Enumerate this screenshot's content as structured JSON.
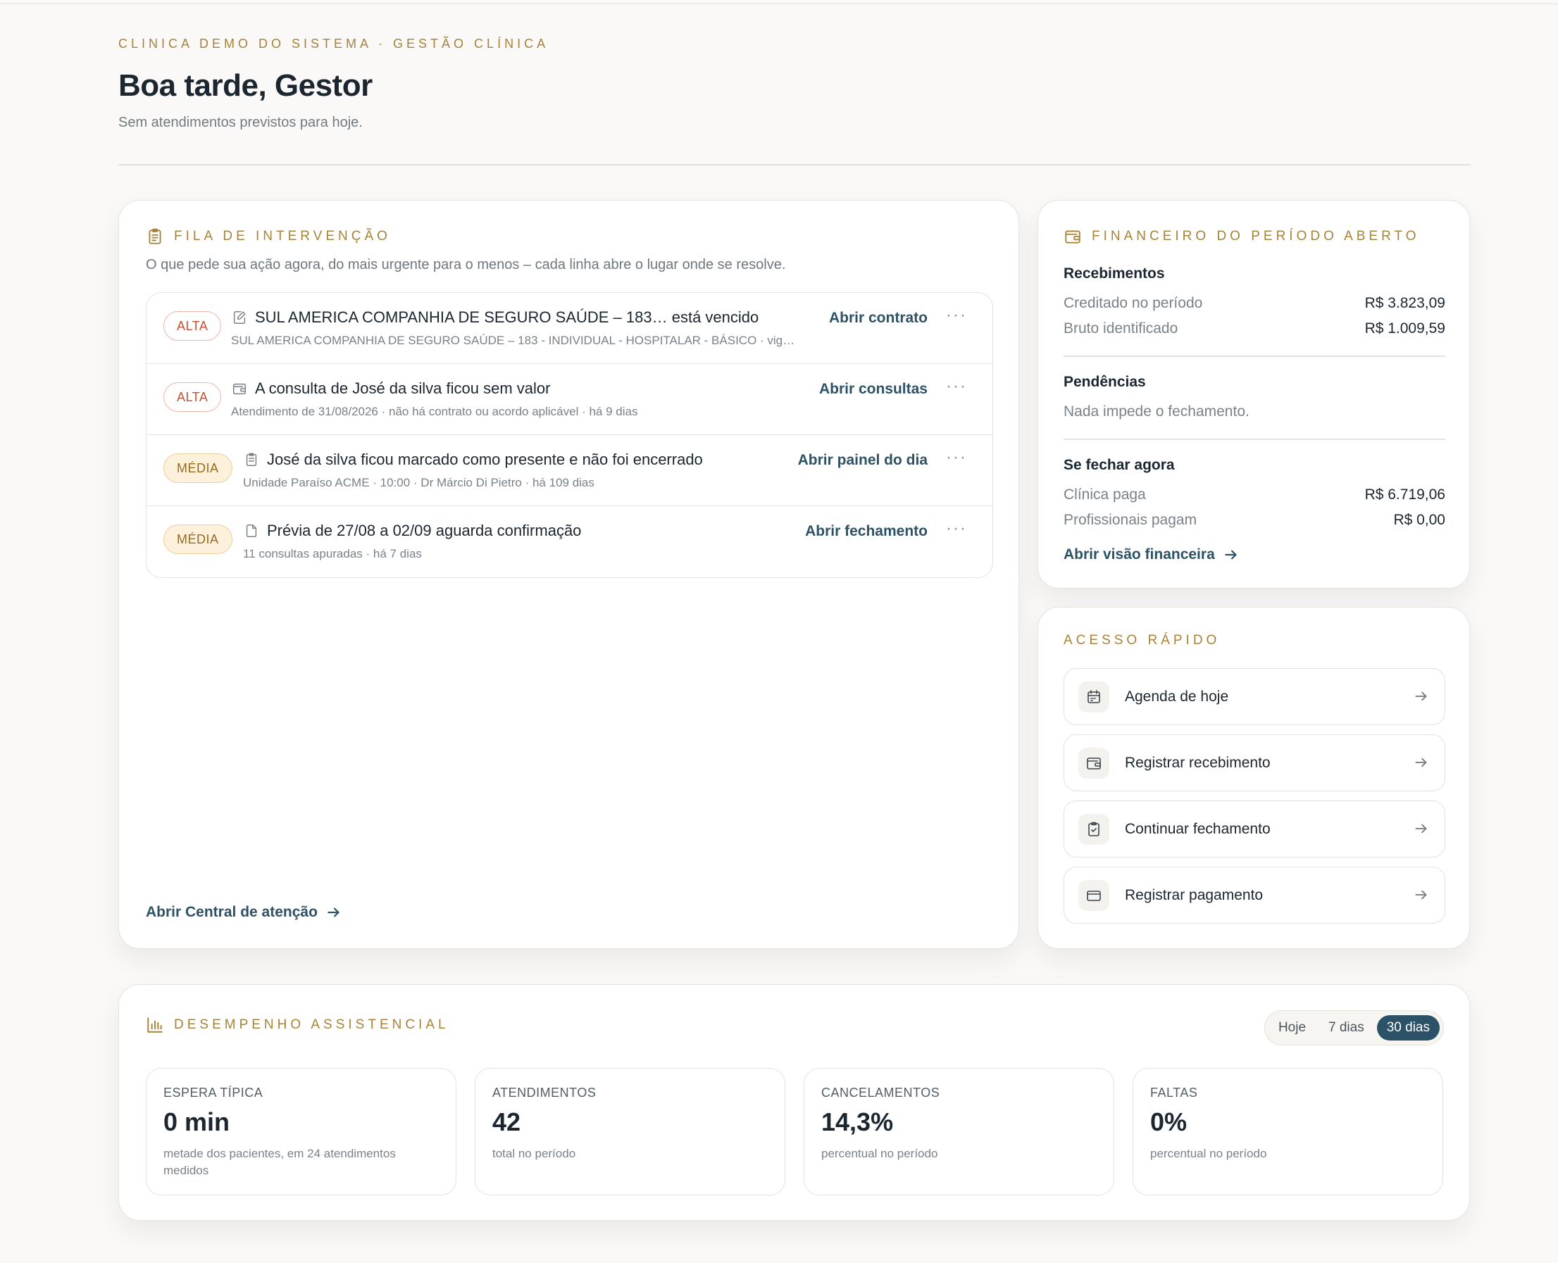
{
  "header": {
    "eyebrow": "CLINICA DEMO DO SISTEMA · GESTÃO CLÍNICA",
    "greeting": "Boa tarde, Gestor",
    "subtitle": "Sem atendimentos previstos para hoje."
  },
  "fila": {
    "title": "FILA DE INTERVENÇÃO",
    "description": "O que pede sua ação agora, do mais urgente para o menos – cada linha abre o lugar onde se resolve.",
    "rows": [
      {
        "badge": "ALTA",
        "icon": "contract-edit-icon",
        "title": "SUL AMERICA COMPANHIA DE SEGURO SAÚDE – 183… está vencido",
        "subtitle": "SUL AMERICA COMPANHIA DE SEGURO SAÚDE – 183 - INDIVIDUAL - HOSPITALAR - BÁSICO · vig…",
        "action": "Abrir contrato",
        "more": "···"
      },
      {
        "badge": "ALTA",
        "icon": "wallet-icon",
        "title": "A consulta de José da silva ficou sem valor",
        "subtitle": "Atendimento de 31/08/2026 · não há contrato ou acordo aplicável · há 9 dias",
        "action": "Abrir consultas",
        "more": "···"
      },
      {
        "badge": "MÉDIA",
        "icon": "clipboard-icon",
        "title": "José da silva ficou marcado como presente e não foi encerrado",
        "subtitle": "Unidade Paraíso ACME · 10:00 · Dr Márcio Di Pietro · há 109 dias",
        "action": "Abrir painel do dia",
        "more": "···"
      },
      {
        "badge": "MÉDIA",
        "icon": "document-icon",
        "title": "Prévia de 27/08 a 02/09 aguarda confirmação",
        "subtitle": "11 consultas apuradas · há 7 dias",
        "action": "Abrir fechamento",
        "more": "···"
      }
    ],
    "footer_link": "Abrir Central de atenção"
  },
  "financeiro": {
    "title": "FINANCEIRO DO PERÍODO ABERTO",
    "recebimentos": {
      "heading": "Recebimentos",
      "rows": [
        {
          "label": "Creditado no período",
          "value": "R$ 3.823,09"
        },
        {
          "label": "Bruto identificado",
          "value": "R$ 1.009,59"
        }
      ]
    },
    "pendencias": {
      "heading": "Pendências",
      "note": "Nada impede o fechamento."
    },
    "fechar": {
      "heading": "Se fechar agora",
      "rows": [
        {
          "label": "Clínica paga",
          "value": "R$ 6.719,06"
        },
        {
          "label": "Profissionais pagam",
          "value": "R$ 0,00"
        }
      ]
    },
    "link": "Abrir visão financeira"
  },
  "acesso": {
    "title": "ACESSO RÁPIDO",
    "items": [
      {
        "label": "Agenda de hoje",
        "icon": "calendar-icon"
      },
      {
        "label": "Registrar recebimento",
        "icon": "wallet-icon"
      },
      {
        "label": "Continuar fechamento",
        "icon": "clipboard-check-icon"
      },
      {
        "label": "Registrar pagamento",
        "icon": "credit-card-icon"
      }
    ]
  },
  "desempenho": {
    "title": "DESEMPENHO ASSISTENCIAL",
    "periods": [
      "Hoje",
      "7 dias",
      "30 dias"
    ],
    "active_period": "30 dias",
    "metrics": [
      {
        "label": "ESPERA TÍPICA",
        "value": "0 min",
        "description": "metade dos pacientes, em 24 atendimentos medidos"
      },
      {
        "label": "ATENDIMENTOS",
        "value": "42",
        "description": "total no período"
      },
      {
        "label": "CANCELAMENTOS",
        "value": "14,3%",
        "description": "percentual no período"
      },
      {
        "label": "FALTAS",
        "value": "0%",
        "description": "percentual no período"
      }
    ]
  },
  "colors": {
    "accent_gold": "#a88239",
    "link_blue": "#2d5266",
    "alta": "#c8502f",
    "media": "#9a6b1c"
  }
}
